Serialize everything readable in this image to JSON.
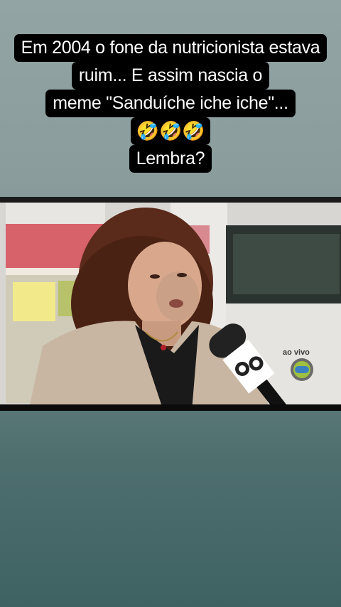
{
  "caption": {
    "lines": [
      "Em 2004 o fone da nutricionista estava",
      "ruim... E assim nascia o",
      "meme \"Sanduíche iche iche\"...",
      "🤣🤣🤣",
      "Lembra?"
    ]
  },
  "video": {
    "overlay_label": "ao vivo",
    "logo": "globo-logo-icon",
    "colors": {
      "background_top": "#93a4a4",
      "background_bottom": "#3e6262",
      "caption_bg": "#000000",
      "caption_text": "#ffffff"
    }
  }
}
